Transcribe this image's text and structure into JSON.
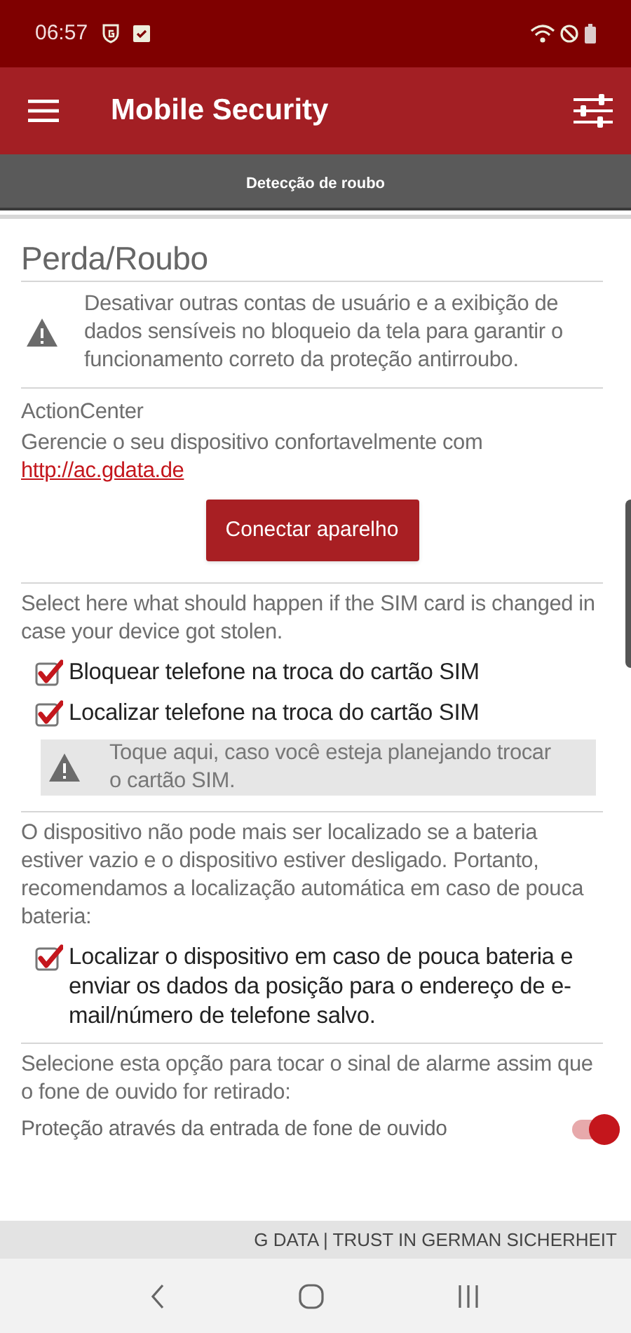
{
  "status_bar": {
    "time": "06:57"
  },
  "app_bar": {
    "title": "Mobile Security"
  },
  "tab": {
    "label": "Detecção de roubo"
  },
  "page_title": "Perda/Roubo",
  "sections": [
    {
      "kind": "warning",
      "text": "Desativar outras contas de usuário e a exibição de dados sensíveis no bloqueio da tela para garantir o funcionamento correto da proteção antirroubo."
    },
    {
      "kind": "action_center",
      "heading": "ActionCenter",
      "text": "Gerencie o seu dispositivo confortavelmente com",
      "link": "http://ac.gdata.de",
      "button": "Conectar aparelho"
    },
    {
      "kind": "options",
      "text": "Select here what should happen if the SIM card is changed in case your device got stolen.",
      "checkboxes": [
        {
          "label": "Bloquear telefone na troca do cartão SIM",
          "checked": true
        },
        {
          "label": "Localizar telefone na troca do cartão SIM",
          "checked": true
        }
      ],
      "note": "Toque aqui, caso você esteja planejando trocar o cartão SIM."
    },
    {
      "kind": "options",
      "text": "O dispositivo não pode mais ser localizado se a bateria estiver vazio e o dispositivo estiver desligado. Portanto, recomendamos a localização automática em caso de pouca bateria:",
      "checkboxes": [
        {
          "label": "Localizar o dispositivo em caso de pouca bateria e enviar os dados da posição para o endereço de e-mail/número de telefone salvo.",
          "checked": true
        }
      ]
    },
    {
      "kind": "switch",
      "text": "Selecione esta opção para tocar o sinal de alarme assim que o fone de ouvido for retirado:",
      "switch_label": "Proteção através da entrada de fone de ouvido",
      "on": true
    }
  ],
  "footer": "G DATA | TRUST IN GERMAN SICHERHEIT"
}
